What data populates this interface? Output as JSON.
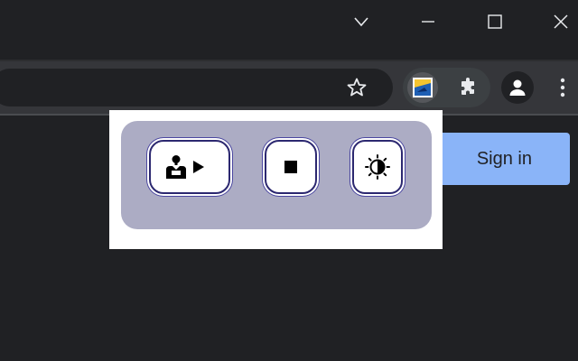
{
  "window_controls": {
    "tab_search": "tab-search-chevron-icon",
    "minimize": "minimize-icon",
    "maximize": "maximize-icon",
    "close": "close-icon"
  },
  "toolbar": {
    "bookmark_icon": "star-outline-icon",
    "extension_icon": "read-aloud-extension-icon",
    "extensions_menu_icon": "puzzle-piece-icon",
    "profile_icon": "person-icon",
    "menu_icon": "kebab-menu-icon"
  },
  "page": {
    "sign_in_label": "Sign in",
    "accent_color": "#8ab4f8"
  },
  "popup": {
    "panel_color": "#acacc4",
    "border_color": "#2c2870",
    "buttons": [
      {
        "name": "read-aloud-play",
        "icon": "reader-play-icon"
      },
      {
        "name": "stop",
        "icon": "stop-square-icon"
      },
      {
        "name": "contrast",
        "icon": "brightness-contrast-icon"
      }
    ]
  }
}
